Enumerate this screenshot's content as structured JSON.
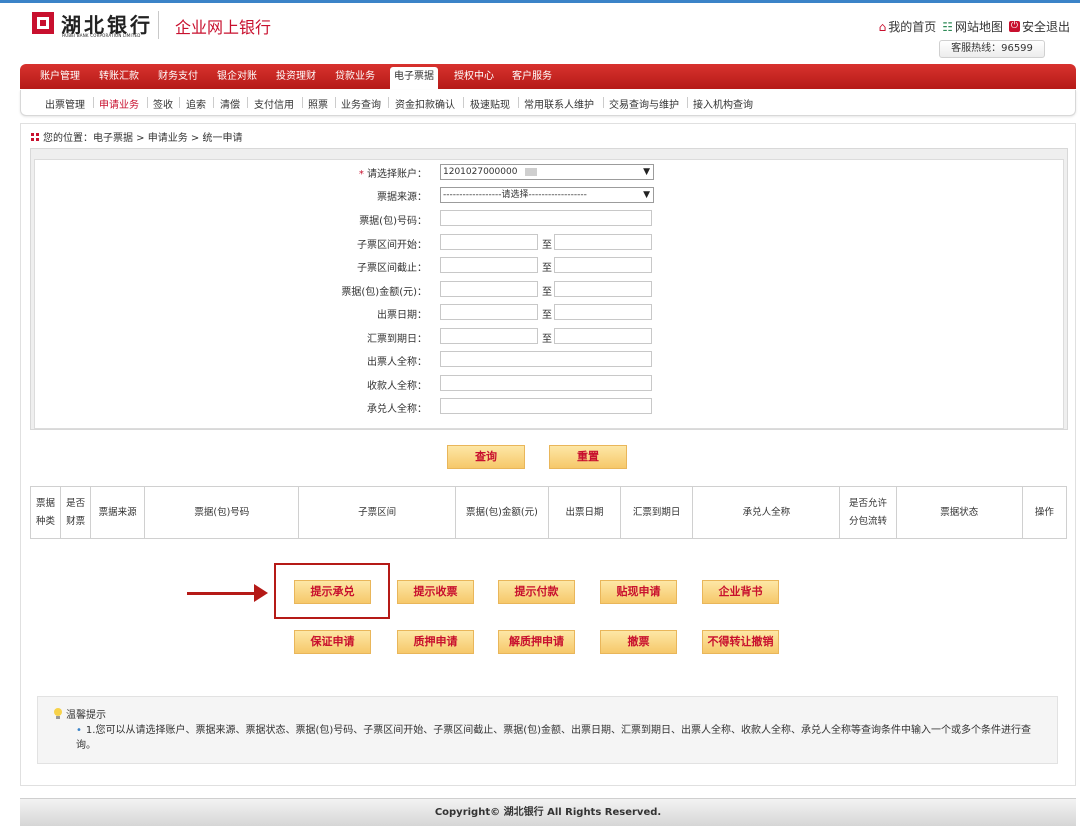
{
  "header": {
    "bank_name_cn": "湖北银行",
    "bank_name_en": "HUBEI BANK CORPORATION LIMITED",
    "product_name": "企业网上银行",
    "links": [
      "我的首页",
      "网站地图",
      "安全退出"
    ],
    "hotline": "客服热线：96599"
  },
  "main_nav": {
    "items": [
      "账户管理",
      "转账汇款",
      "财务支付",
      "银企对账",
      "投资理财",
      "贷款业务",
      "电子票据",
      "授权中心",
      "客户服务"
    ],
    "active": "电子票据"
  },
  "sub_nav": {
    "items": [
      "出票管理",
      "申请业务",
      "签收",
      "追索",
      "清偿",
      "支付信用",
      "照票",
      "业务查询",
      "资金扣款确认",
      "极速贴现",
      "常用联系人维护",
      "交易查询与维护",
      "接入机构查询"
    ],
    "active": "申请业务"
  },
  "breadcrumb": "您的位置：电子票据 > 申请业务 > 统一申请",
  "form": {
    "account_label": "请选择账户：",
    "account_value": "1201027000000",
    "source_label": "票据来源：",
    "source_value": "------------------请选择------------------",
    "number_label": "票据(包)号码：",
    "sub_start_label": "子票区间开始：",
    "sub_end_label": "子票区间截止：",
    "amount_label": "票据(包)金额(元)：",
    "issue_date_label": "出票日期：",
    "due_date_label": "汇票到期日：",
    "drawer_label": "出票人全称：",
    "payee_label": "收款人全称：",
    "acceptor_label": "承兑人全称：",
    "range_sep": "至"
  },
  "buttons": {
    "query": "查询",
    "reset": "重置"
  },
  "table": {
    "headers": [
      [
        "票据",
        "种类"
      ],
      [
        "是否",
        "财票"
      ],
      [
        "票据来源"
      ],
      [
        "票据(包)号码"
      ],
      [
        "子票区间"
      ],
      [
        "票据(包)金额(元)"
      ],
      [
        "出票日期"
      ],
      [
        "汇票到期日"
      ],
      [
        "承兑人全称"
      ],
      [
        "是否允许",
        "分包流转"
      ],
      [
        "票据状态"
      ],
      [
        "操作"
      ]
    ]
  },
  "actions": {
    "row1": [
      "提示承兑",
      "提示收票",
      "提示付款",
      "贴现申请",
      "企业背书"
    ],
    "row2": [
      "保证申请",
      "质押申请",
      "解质押申请",
      "撤票",
      "不得转让撤销"
    ]
  },
  "tips": {
    "title": "温馨提示",
    "text": "1.您可以从请选择账户、票据来源、票据状态、票据(包)号码、子票区间开始、子票区间截止、票据(包)金额、出票日期、汇票到期日、出票人全称、收款人全称、承兑人全称等查询条件中输入一个或多个条件进行查询。"
  },
  "footer": "Copyright© 湖北银行 All Rights Reserved.",
  "colors": {
    "brand_red": "#c8102e",
    "nav_red": "#b51a17",
    "button_gold": "#f6c86a",
    "accent_blue": "#3b83c8"
  }
}
